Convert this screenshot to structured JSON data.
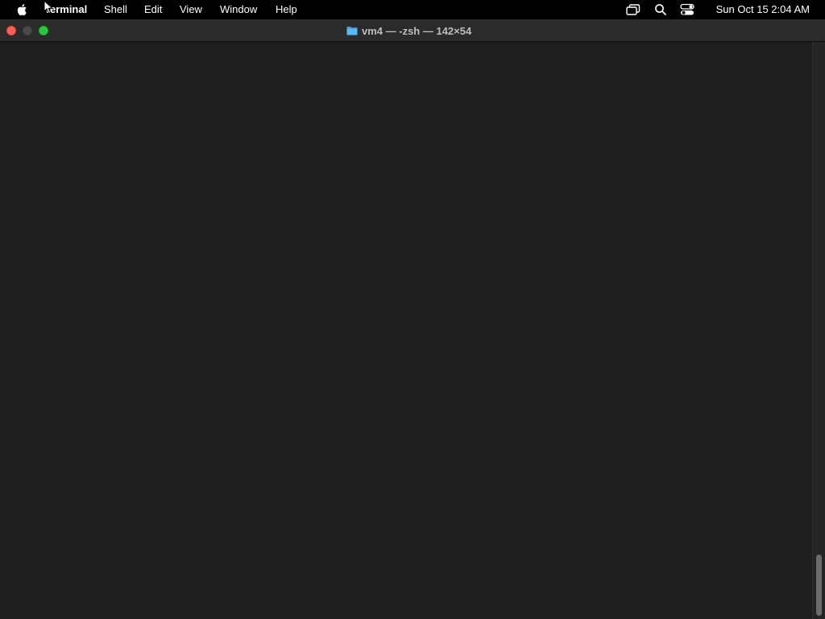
{
  "menubar": {
    "apple_icon": "apple-icon",
    "items": [
      {
        "label": "Terminal",
        "bold": true
      },
      {
        "label": "Shell"
      },
      {
        "label": "Edit"
      },
      {
        "label": "View"
      },
      {
        "label": "Window"
      },
      {
        "label": "Help"
      }
    ],
    "status_icons": [
      "screen-mirroring-icon",
      "search-icon",
      "control-center-icon"
    ],
    "clock": "Sun Oct 15  2:04 AM"
  },
  "window": {
    "title": "vm4 — -zsh — 142×54",
    "folder_icon": "folder-icon",
    "colors": {
      "close": "#ff5f57",
      "minimize": "#4a4a4a",
      "zoom": "#28c840",
      "background": "#1e1e1e"
    }
  }
}
